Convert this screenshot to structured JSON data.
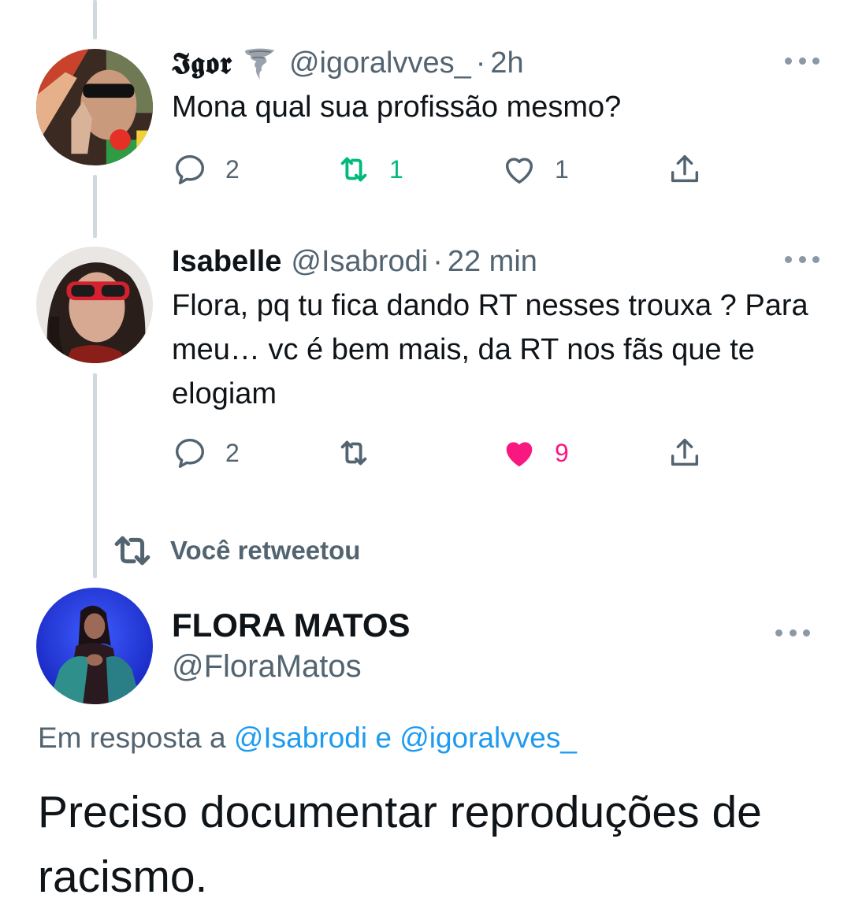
{
  "tweets": [
    {
      "name": "𝕴𝖌𝖔𝖗",
      "emoji_icon": "tornado-icon",
      "handle": "@igoralvves_",
      "separator": "·",
      "time": "2h",
      "text": "Mona qual sua profissão mesmo?",
      "replies": "2",
      "retweets": "1",
      "likes": "1",
      "retweeted": true,
      "liked": false
    },
    {
      "name": "Isabelle",
      "handle": "@Isabrodi",
      "separator": "·",
      "time": "22 min",
      "text": "Flora, pq tu fica dando RT nesses trouxa ? Para meu… vc é bem mais, da RT nos fãs que te elogiam",
      "replies": "2",
      "retweets": "",
      "likes": "9",
      "retweeted": false,
      "liked": true
    }
  ],
  "retweeted_label": "Você retweetou",
  "main": {
    "name": "FLORA MATOS",
    "handle": "@FloraMatos",
    "reply_prefix": "Em resposta a",
    "reply_user1": "@Isabrodi",
    "reply_joiner": "e",
    "reply_user2": "@igoralvves_",
    "text": "Preciso documentar reproduções de racismo."
  },
  "colors": {
    "retweet_green": "#00ba7c",
    "like_pink": "#f91880",
    "link_blue": "#1d9bf0",
    "secondary_gray": "#536471",
    "thread_line": "#cfd9de"
  }
}
